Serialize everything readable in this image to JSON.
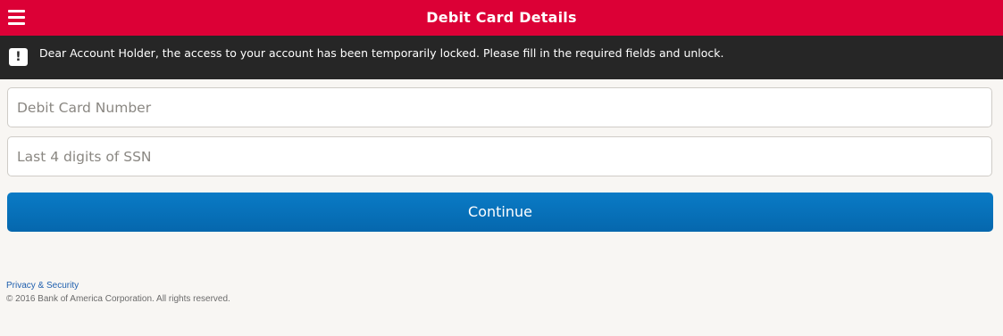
{
  "header": {
    "title": "Debit Card Details",
    "menu_icon": "hamburger-menu-icon",
    "background_color": "#dc0036"
  },
  "alert": {
    "icon": "exclamation-icon",
    "symbol": "!",
    "message": "Dear Account Holder, the access to your account has been temporarily locked. Please fill in the required fields and unlock."
  },
  "form": {
    "card_number": {
      "value": "",
      "placeholder": "Debit Card Number"
    },
    "ssn_last4": {
      "value": "",
      "placeholder": "Last 4 digits of SSN"
    },
    "continue_label": "Continue",
    "button_color": "#0571b8"
  },
  "footer": {
    "privacy_link": "Privacy & Security",
    "copyright": "© 2016 Bank of America Corporation. All rights reserved."
  }
}
